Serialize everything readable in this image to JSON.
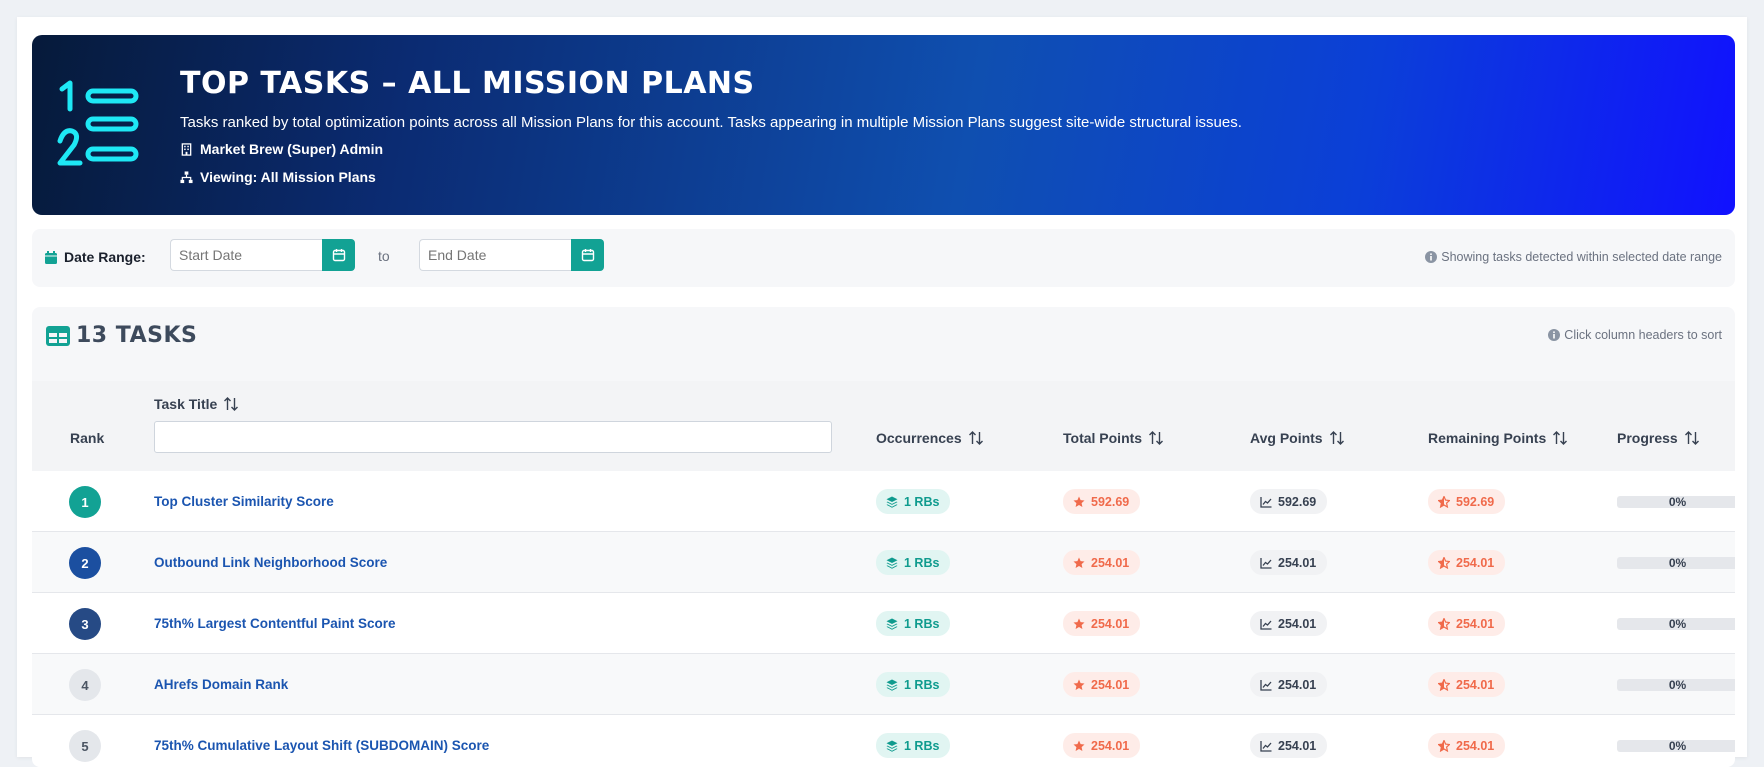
{
  "header": {
    "title": "Top Tasks – All Mission Plans",
    "description": "Tasks ranked by total optimization points across all Mission Plans for this account. Tasks appearing in multiple Mission Plans suggest site-wide structural issues.",
    "account": "Market Brew (Super) Admin",
    "viewing": "Viewing: All Mission Plans",
    "icon": "list-ol-icon",
    "accent": "#00e5ff"
  },
  "date_range": {
    "label": "Date Range:",
    "start_placeholder": "Start Date",
    "to": "to",
    "end_placeholder": "End Date",
    "note": "Showing tasks detected within selected date range"
  },
  "tasks_panel": {
    "title": "13 Tasks",
    "sort_note": "Click column headers to sort"
  },
  "columns": {
    "rank": "Rank",
    "task_title": "Task Title",
    "occurrences": "Occurrences",
    "total_points": "Total Points",
    "avg_points": "Avg Points",
    "remaining_points": "Remaining Points",
    "progress": "Progress"
  },
  "rows": [
    {
      "rank": "1",
      "title": "Top Cluster Similarity Score",
      "occurrences": "1 RBs",
      "total": "592.69",
      "avg": "592.69",
      "remaining": "592.69",
      "progress": "0%",
      "rank_bg": "#12a294",
      "rank_fg": "#ffffff"
    },
    {
      "rank": "2",
      "title": "Outbound Link Neighborhood Score",
      "occurrences": "1 RBs",
      "total": "254.01",
      "avg": "254.01",
      "remaining": "254.01",
      "progress": "0%",
      "rank_bg": "#1b4fa0",
      "rank_fg": "#ffffff"
    },
    {
      "rank": "3",
      "title": "75th% Largest Contentful Paint Score",
      "occurrences": "1 RBs",
      "total": "254.01",
      "avg": "254.01",
      "remaining": "254.01",
      "progress": "0%",
      "rank_bg": "#264a85",
      "rank_fg": "#ffffff"
    },
    {
      "rank": "4",
      "title": "AHrefs Domain Rank",
      "occurrences": "1 RBs",
      "total": "254.01",
      "avg": "254.01",
      "remaining": "254.01",
      "progress": "0%",
      "rank_bg": "#e4e7eb",
      "rank_fg": "#4b5563"
    },
    {
      "rank": "5",
      "title": "75th% Cumulative Layout Shift (SUBDOMAIN) Score",
      "occurrences": "1 RBs",
      "total": "254.01",
      "avg": "254.01",
      "remaining": "254.01",
      "progress": "0%",
      "rank_bg": "#e4e7eb",
      "rank_fg": "#4b5563"
    }
  ]
}
